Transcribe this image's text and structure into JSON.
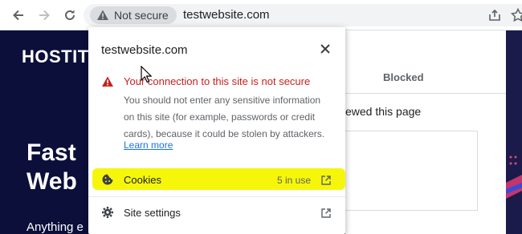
{
  "toolbar": {
    "security_chip_label": "Not secure",
    "url": "testwebsite.com"
  },
  "site": {
    "logo": "HOSTIT",
    "heading": "Fast Web",
    "subtext": "Anything e",
    "panel_tab": "Blocked",
    "panel_text": "ewed this page"
  },
  "popup": {
    "domain": "testwebsite.com",
    "warning_title": "Your connection to this site is not secure",
    "warning_body": "You should not enter any sensitive information on this site (for example, passwords or credit cards), because it could be stolen by attackers.",
    "learn_more": "Learn more",
    "cookies": {
      "label": "Cookies",
      "count": "5 in use"
    },
    "site_settings": {
      "label": "Site settings"
    }
  },
  "colors": {
    "warning_red": "#c5221f",
    "link_blue": "#1a73e8",
    "highlight_yellow": "#f6f60a",
    "site_bg": "#0b0f3a"
  },
  "icons": [
    "back-arrow-icon",
    "forward-arrow-icon",
    "reload-icon",
    "warning-triangle-icon",
    "share-icon",
    "star-icon",
    "close-icon",
    "cookie-icon",
    "gear-icon",
    "external-link-icon",
    "mouse-cursor-icon"
  ]
}
